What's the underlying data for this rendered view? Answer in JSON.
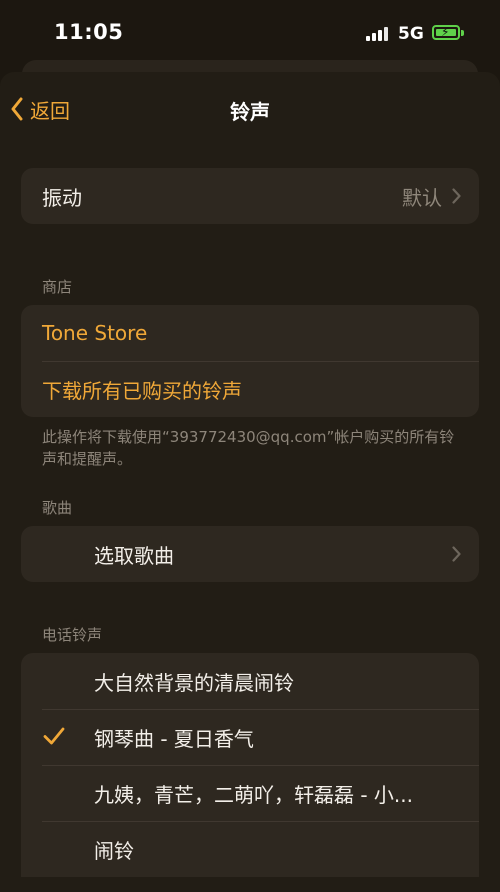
{
  "status": {
    "time": "11:05",
    "network": "5G"
  },
  "nav": {
    "back_label": "返回",
    "title": "铃声"
  },
  "vibration": {
    "label": "振动",
    "value": "默认"
  },
  "store": {
    "header": "商店",
    "tone_store": "Tone Store",
    "download_all": "下载所有已购买的铃声",
    "footnote": "此操作将下载使用“393772430@qq.com”帐户购买的所有铃声和提醒声。"
  },
  "songs": {
    "header": "歌曲",
    "pick_song": "选取歌曲"
  },
  "ringtones": {
    "header": "电话铃声",
    "items": [
      {
        "label": "大自然背景的清晨闹铃",
        "selected": false
      },
      {
        "label": "钢琴曲 - 夏日香气",
        "selected": true
      },
      {
        "label": "九姨，青芒，二萌吖，轩磊磊 - 小...",
        "selected": false
      },
      {
        "label": "闹铃",
        "selected": false
      }
    ]
  },
  "colors": {
    "accent": "#f0a838",
    "battery": "#5fd14a",
    "background": "#221d15",
    "card": "#2e2820"
  }
}
